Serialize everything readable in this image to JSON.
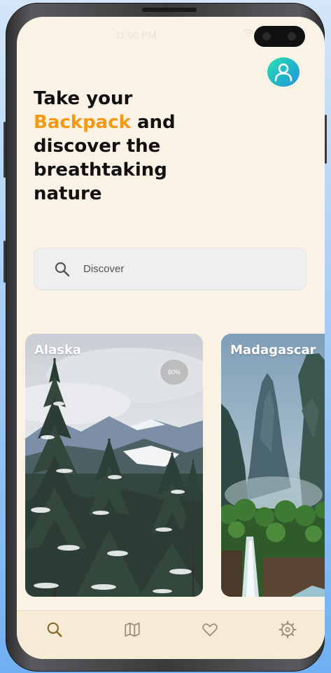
{
  "status_bar": {
    "time": "11:00 PM"
  },
  "header": {
    "headline_before": "Take your",
    "headline_accent": "Backpack",
    "headline_after": " and discover the breathtaking nature"
  },
  "search": {
    "placeholder": "Discover",
    "icon": "search-icon"
  },
  "destinations": [
    {
      "name": "Alaska",
      "badge": "80%"
    },
    {
      "name": "Madagascar"
    }
  ],
  "bottom_nav": [
    {
      "icon": "search-icon",
      "active": true
    },
    {
      "icon": "map-icon",
      "active": false
    },
    {
      "icon": "heart-icon",
      "active": false
    },
    {
      "icon": "settings-icon",
      "active": false
    }
  ],
  "colors": {
    "accent": "#f29a13",
    "background": "#faf2e4",
    "navbar": "#f6ecd6",
    "nav_active": "#8a6a2c",
    "nav_inactive": "#9a8c78"
  }
}
